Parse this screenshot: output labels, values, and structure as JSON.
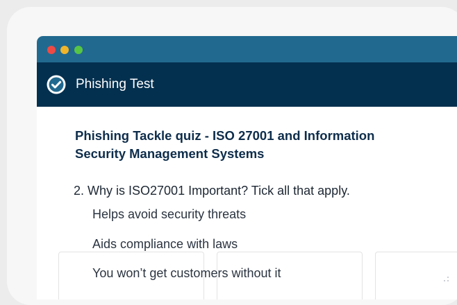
{
  "window": {
    "controls": [
      "close",
      "minimize",
      "maximize"
    ]
  },
  "app": {
    "title": "Phishing Test",
    "icon": "check-circle-icon",
    "accent": "#22698f",
    "header_bg": "#04304f"
  },
  "quiz": {
    "title": "Phishing Tackle quiz - ISO 27001 and Information Security Management Systems",
    "question": "2. Why is ISO27001 Important? Tick all that apply.",
    "options": [
      {
        "label": "Helps avoid security threats"
      },
      {
        "label": "Aids compliance with laws"
      },
      {
        "label": "You won’t get customers without it"
      }
    ]
  }
}
